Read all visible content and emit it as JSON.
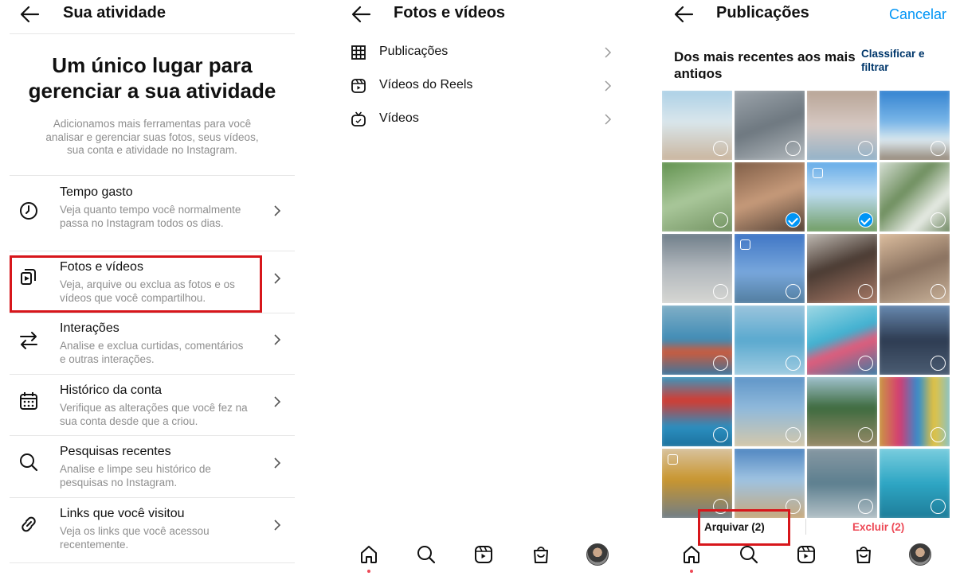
{
  "colors": {
    "accent": "#0095f6",
    "danger": "#ed4956",
    "highlight": "#d7161b",
    "text": "#262626",
    "secondary": "#8e8e8e"
  },
  "activity": {
    "title": "Sua atividade",
    "hero_title": "Um único lugar para gerenciar a sua atividade",
    "hero_sub": "Adicionamos mais ferramentas para você analisar e gerenciar suas fotos, seus vídeos, sua conta e atividade no Instagram.",
    "items": [
      {
        "icon": "clock-icon",
        "title": "Tempo gasto",
        "desc": "Veja quanto tempo você normalmente passa no Instagram todos os dias."
      },
      {
        "icon": "media-icon",
        "title": "Fotos e vídeos",
        "desc": "Veja, arquive ou exclua as fotos e os vídeos que você compartilhou."
      },
      {
        "icon": "swap-arrows-icon",
        "title": "Interações",
        "desc": "Analise e exclua curtidas, comentários e outras interações."
      },
      {
        "icon": "calendar-icon",
        "title": "Histórico da conta",
        "desc": "Verifique as alterações que você fez na sua conta desde que a criou."
      },
      {
        "icon": "search-icon",
        "title": "Pesquisas recentes",
        "desc": "Analise e limpe seu histórico de pesquisas no Instagram."
      },
      {
        "icon": "link-icon",
        "title": "Links que você visitou",
        "desc": "Veja os links que você acessou recentemente."
      }
    ]
  },
  "photos_videos": {
    "title": "Fotos e vídeos",
    "items": [
      {
        "icon": "grid-icon",
        "label": "Publicações"
      },
      {
        "icon": "reels-icon",
        "label": "Vídeos do Reels"
      },
      {
        "icon": "igtv-icon",
        "label": "Vídeos"
      }
    ]
  },
  "posts": {
    "title": "Publicações",
    "cancel": "Cancelar",
    "sort_label": "Dos mais recentes aos mais antigos",
    "sort_button": "Classificar e filtrar",
    "archive_button": "Arquivar (2)",
    "delete_button": "Excluir (2)",
    "selected": [
      5,
      6
    ]
  },
  "nav": [
    "home-icon",
    "search-icon",
    "reels-icon",
    "shop-icon",
    "profile-avatar"
  ]
}
